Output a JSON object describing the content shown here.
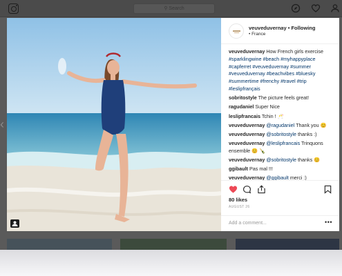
{
  "topbar": {
    "search_placeholder": "⚲ Search",
    "icons": [
      "instagram-logo-icon",
      "compass-icon",
      "heart-icon",
      "profile-icon"
    ]
  },
  "post": {
    "username": "veuveduvernay",
    "separator": "•",
    "follow_status": "Following",
    "location": "• France",
    "likes": "80 likes",
    "date": "AUGUST 26",
    "add_comment_placeholder": "Add a comment...",
    "more": "•••",
    "comments": [
      {
        "user": "veuveduvernay",
        "parts": [
          {
            "t": "text",
            "v": "How French girls exercise "
          },
          {
            "t": "mention",
            "v": "#sparklingwine #beach #myhappyplace #capferret #veuveduvernay #summer #veuveduvernay #beachvibes #bluesky #summertime #frenchy #travel #trip #leslipfrançais"
          }
        ]
      },
      {
        "user": "sobritostyle",
        "parts": [
          {
            "t": "text",
            "v": "The picture feels great!"
          }
        ]
      },
      {
        "user": "ragudaniel",
        "parts": [
          {
            "t": "text",
            "v": "Super Nice"
          }
        ]
      },
      {
        "user": "leslipfrancais",
        "parts": [
          {
            "t": "text",
            "v": "Tchin ! 🥂"
          }
        ]
      },
      {
        "user": "veuveduvernay",
        "parts": [
          {
            "t": "mention",
            "v": "@ragudaniel"
          },
          {
            "t": "text",
            "v": " Thank you 😊"
          }
        ]
      },
      {
        "user": "veuveduvernay",
        "parts": [
          {
            "t": "mention",
            "v": "@sobritostyle"
          },
          {
            "t": "text",
            "v": " thanks :)"
          }
        ]
      },
      {
        "user": "veuveduvernay",
        "parts": [
          {
            "t": "mention",
            "v": "@leslipfrancais"
          },
          {
            "t": "text",
            "v": " Trinquons ensemble 😊 🍾"
          }
        ]
      },
      {
        "user": "veuveduvernay",
        "parts": [
          {
            "t": "mention",
            "v": "@sobritostyle"
          },
          {
            "t": "text",
            "v": " thanks 😊"
          }
        ]
      },
      {
        "user": "ggibault",
        "parts": [
          {
            "t": "text",
            "v": "Pas mal !!!"
          }
        ]
      },
      {
        "user": "veuveduvernay",
        "parts": [
          {
            "t": "mention",
            "v": "@ggibault"
          },
          {
            "t": "text",
            "v": " merci :)"
          }
        ]
      }
    ]
  },
  "colors": {
    "like_red": "#ed4956",
    "mention_blue": "#003569",
    "sky": "#9fcbe9",
    "sea": "#3f8fb8",
    "swimsuit": "#1f3f7a"
  }
}
